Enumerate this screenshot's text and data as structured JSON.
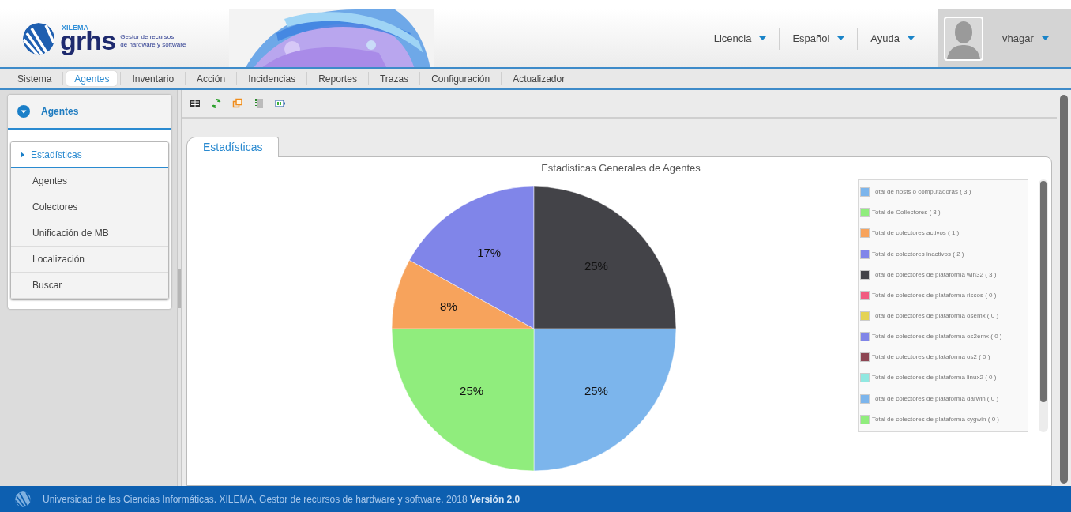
{
  "header": {
    "logo": {
      "brand": "XILEMA",
      "product": "grhs",
      "tagline_1": "Gestor de recursos",
      "tagline_2": "de hardware y software"
    },
    "menus": [
      {
        "label": "Licencia"
      },
      {
        "label": "Español"
      },
      {
        "label": "Ayuda"
      }
    ],
    "user": {
      "name": "vhagar"
    }
  },
  "nav": {
    "tabs": [
      {
        "label": "Sistema",
        "selected": false
      },
      {
        "label": "Agentes",
        "selected": true
      },
      {
        "label": "Inventario",
        "selected": false
      },
      {
        "label": "Acción",
        "selected": false
      },
      {
        "label": "Incidencias",
        "selected": false
      },
      {
        "label": "Reportes",
        "selected": false
      },
      {
        "label": "Trazas",
        "selected": false
      },
      {
        "label": "Configuración",
        "selected": false
      },
      {
        "label": "Actualizador",
        "selected": false
      }
    ]
  },
  "sidebar": {
    "title": "Agentes",
    "items": [
      {
        "label": "Estadísticas",
        "selected": true
      },
      {
        "label": "Agentes",
        "selected": false
      },
      {
        "label": "Colectores",
        "selected": false
      },
      {
        "label": "Unificación de MB",
        "selected": false
      },
      {
        "label": "Localización",
        "selected": false
      },
      {
        "label": "Buscar",
        "selected": false
      }
    ]
  },
  "content": {
    "tabs": [
      {
        "label": "Estadísticas",
        "selected": true
      }
    ],
    "chart_data": {
      "type": "pie",
      "title": "Estadisticas Generales de Agentes",
      "categories": [
        "Total de hosts o computadoras ( 3 )",
        "Total de Collectores ( 3 )",
        "Total de colectores activos ( 1 )",
        "Total de colectores inactivos ( 2 )",
        "Total de colectores de plataforma win32 ( 3 )",
        "Total de colectores de plataforma riscos ( 0 )",
        "Total de colectores de plataforma osemx ( 0 )",
        "Total de colectores de plataforma os2emx ( 0 )",
        "Total de colectores de plataforma os2 ( 0 )",
        "Total de colectores de plataforma linux2 ( 0 )",
        "Total de colectores de plataforma darwin ( 0 )",
        "Total de colectores de plataforma cygwin ( 0 )"
      ],
      "values": [
        25,
        25,
        8,
        17,
        25,
        0,
        0,
        0,
        0,
        0,
        0,
        0
      ],
      "colors": [
        "#7cb5ec",
        "#90ed7d",
        "#f7a35c",
        "#8085e9",
        "#434348",
        "#f15c80",
        "#e4d354",
        "#8085e8",
        "#8d4653",
        "#91e8e1",
        "#7cb5ec",
        "#90ed7d"
      ],
      "value_labels": [
        "25%",
        "25%",
        "8%",
        "17%",
        "25%",
        null,
        null,
        null,
        null,
        null,
        null,
        null
      ]
    }
  },
  "footer": {
    "text": "Universidad de las Ciencias Informáticas. XILEMA, Gestor de recursos de hardware y software. 2018 **Versión 2.0**"
  }
}
